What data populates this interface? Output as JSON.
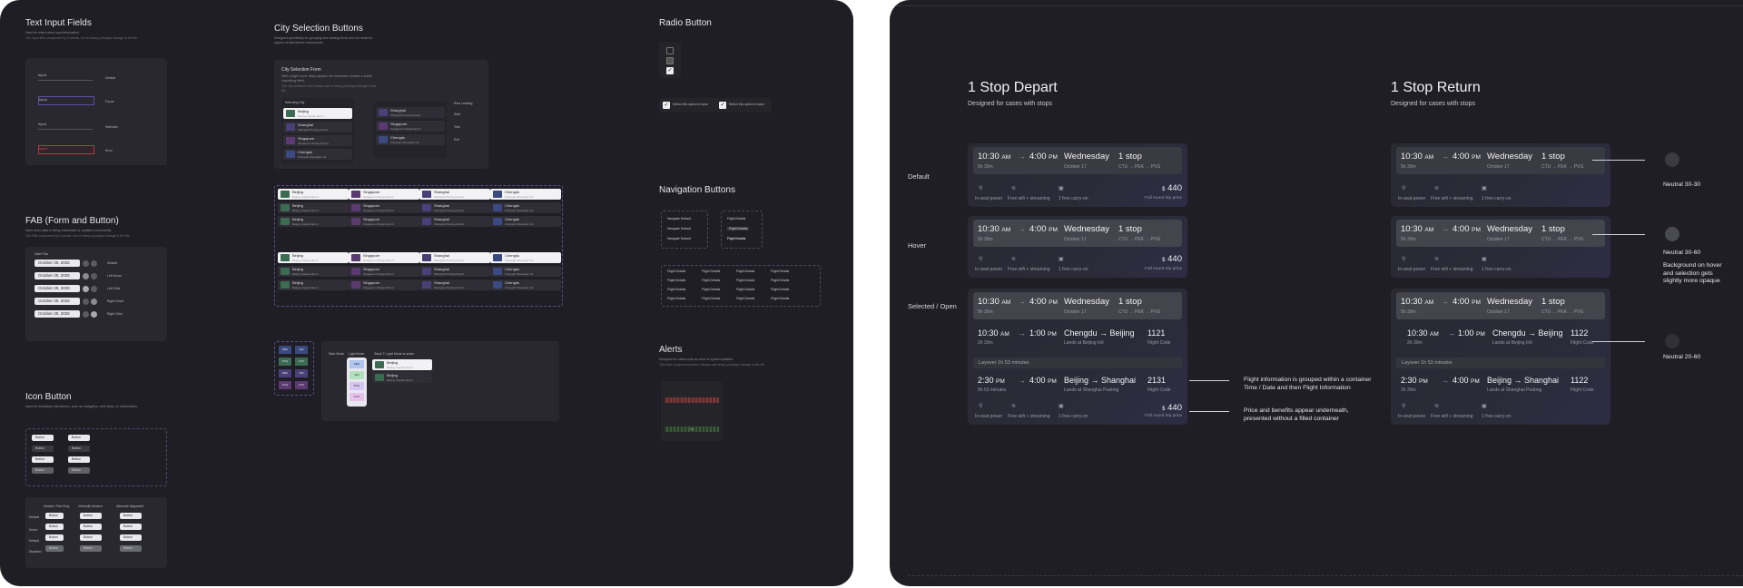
{
  "left": {
    "text_input": {
      "title": "Text Input Fields",
      "sub1": "Used for when users input information",
      "sub2": "The input field component by Codelab, but re-heavy prototype linkage in the file.",
      "fields": [
        "Input",
        "Input",
        "Input",
        "Input"
      ],
      "states": [
        "Default",
        "Focus",
        "Selected",
        "Error"
      ]
    },
    "fab": {
      "title": "FAB (Form and Button)",
      "sub1": "Used when data is being transmitted or updated concurrently",
      "sub2": "The FAB component by Codelab, but re-heavy prototype linkage in the file.",
      "head": "Date Pick",
      "dates": [
        "October 29, 2025",
        "October 29, 2025",
        "October 29, 2025",
        "October 29, 2025",
        "October 29, 2025"
      ],
      "states": [
        "Default",
        "Left Hover",
        "Left Click",
        "Right Hover",
        "Right Click"
      ]
    },
    "icon_button": {
      "title": "Icon Button",
      "sub": "Used for subsidiary interactions, such as navigation, next steps, or confirmation.",
      "label": "Button",
      "cols": [
        "Default / Flat Grey",
        "Vertically Modern",
        "Alternate Alignment"
      ],
      "rows": [
        "Default",
        "Hover",
        "Default",
        "Disabled"
      ]
    },
    "city": {
      "title": "City Selection Buttons",
      "sub": "Designed specifically for grouping and making forms and not meant to appear as standalone components.",
      "form_title": "City Selection Form",
      "form_sub": "With a slight hover delay applied, the interaction creates a subtle cascading effect.",
      "form_sub2": "The city selection form shares use to heavy prototype linkage in the file.",
      "selecting": "Selecting City",
      "cities": [
        {
          "name": "Beijing",
          "desc": "Beijing Capital Airport",
          "color": "#3b6b50"
        },
        {
          "name": "Shanghai",
          "desc": "Shanghai Pudong Airport",
          "color": "#4a4078"
        },
        {
          "name": "Singapore",
          "desc": "Singapore Changi Airport",
          "color": "#5a3a70"
        },
        {
          "name": "Chengdu",
          "desc": "Chengdu Shuangliu Intl",
          "color": "#3a4a80"
        }
      ],
      "grid_selected": [
        "Beijing",
        "Singapore",
        "Shanghai",
        "Chengdu"
      ],
      "row_ending": "Row Landing",
      "row_labels": [
        "Start",
        "Test",
        "Exit"
      ],
      "picker_head": "Start Mode",
      "picker_head2": "Light Mode",
      "picker_head3": "Stack T: Light Mode is active",
      "codes": [
        "PEK",
        "SIN",
        "PVG",
        "CTU"
      ]
    },
    "radio": {
      "title": "Radio Button",
      "options": [
        "Select this option to save",
        "Select this option to save"
      ]
    },
    "nav": {
      "title": "Navigation Buttons",
      "stacked": [
        "Navigate Default",
        "Navigate Default",
        "Navigate Default"
      ],
      "flight": "Flight Details"
    },
    "alerts": {
      "title": "Alerts",
      "sub1": "Designed for cases such as error or system updates.",
      "sub2": "This alert component doesn't always use heavy prototype linkage in the file.",
      "ok": "OK"
    }
  },
  "right": {
    "depart": {
      "title": "1 Stop Depart",
      "desc": "Designed for cases with stops"
    },
    "return": {
      "title": "1 Stop Return",
      "desc": "Designed for cases with stops"
    },
    "row_labels": [
      "Default",
      "Hover",
      "Selected / Open"
    ],
    "cards": {
      "dep_time": "10:30",
      "arr_time": "4:00",
      "am": "AM",
      "pm": "PM",
      "arrow": "→",
      "day": "Wednesday",
      "date": "October 17",
      "duration": "5h 30m",
      "stops": "1 stop",
      "route": "CTU → PEK → PVG",
      "perks": [
        "In-seat power",
        "Free wifi + streaming",
        "1 free carry-on"
      ],
      "price_dollar": "$",
      "price": "440",
      "price_sub": "Full round trip price"
    },
    "depart_legs": [
      {
        "dep": "10:30",
        "dep_ampm": "AM",
        "arr": "1:00",
        "arr_ampm": "PM",
        "dur": "2h 30m",
        "route": "Chengdu → Beijing",
        "land": "Lands at Beijing Intl",
        "code": "1121",
        "code_label": "Flight Code"
      },
      {
        "dep": "2:30",
        "dep_ampm": "PM",
        "arr": "4:00",
        "arr_ampm": "PM",
        "dur": "5h 53 minutes",
        "route": "Beijing → Shanghai",
        "land": "Lands at Shanghai Pudong",
        "code": "2131",
        "code_label": "Flight Code"
      }
    ],
    "return_legs": [
      {
        "dep": "10:30",
        "dep_ampm": "AM",
        "arr": "1:00",
        "arr_ampm": "PM",
        "dur": "2h 30m",
        "route": "Chengdu → Beijing",
        "land": "Lands at Beijing Intl",
        "code": "1122",
        "code_label": "Flight Code"
      },
      {
        "dep": "2:30",
        "dep_ampm": "PM",
        "arr": "4:00",
        "arr_ampm": "PM",
        "dur": "2h 30m",
        "route": "Beijing → Shanghai",
        "land": "Lands at Shanghai Pudong",
        "code": "1122",
        "code_label": "Flight Code"
      }
    ],
    "layover": "Layover 1h 53 minutes",
    "annotations": {
      "grouped": [
        "Flight information is grouped within a container",
        "Time / Date and then Flight Information"
      ],
      "price": [
        "Price and benefits appear underneath,",
        "presented without a filled container"
      ],
      "n1": "Neutral 30-30",
      "n2": "Neutral 30-60",
      "n2_desc": [
        "Background on hover",
        "and selection gets",
        "slightly more opaque"
      ],
      "n3": "Neutral 20-60"
    }
  }
}
